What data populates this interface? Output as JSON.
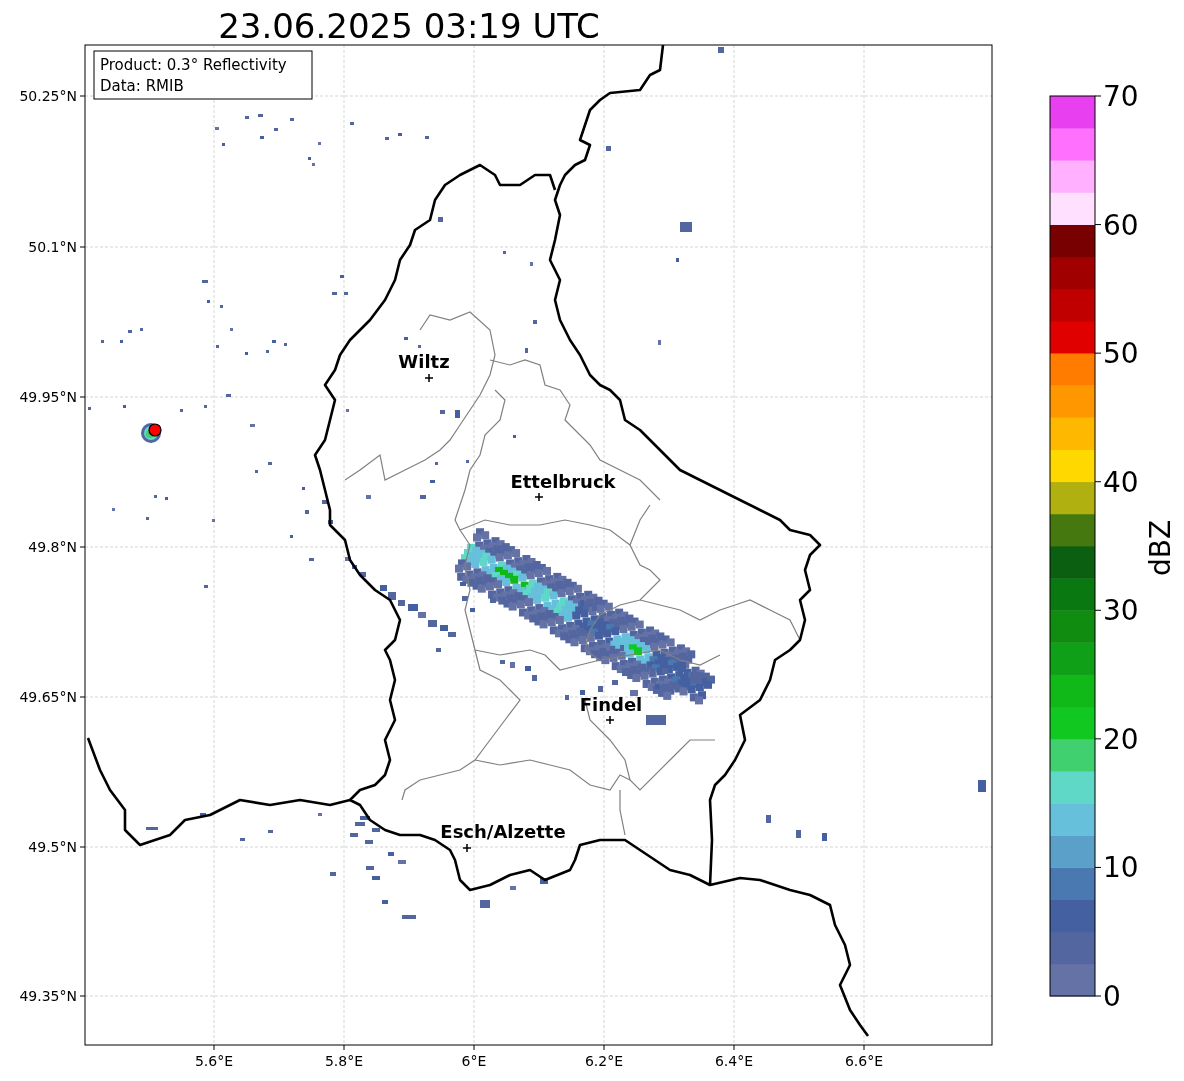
{
  "title": "23.06.2025 03:19 UTC",
  "info_box": [
    "Product: 0.3° Reflectivity",
    "Data: RMIB"
  ],
  "y_axis": {
    "ticks": [
      "50.25°N",
      "50.1°N",
      "49.95°N",
      "49.8°N",
      "49.65°N",
      "49.5°N",
      "49.35°N"
    ]
  },
  "x_axis": {
    "ticks": [
      "5.6°E",
      "5.8°E",
      "6°E",
      "6.2°E",
      "6.4°E",
      "6.6°E"
    ]
  },
  "cities": [
    {
      "name": "Wiltz"
    },
    {
      "name": "Ettelbruck"
    },
    {
      "name": "Findel"
    },
    {
      "name": "Esch/Alzette"
    }
  ],
  "colorbar": {
    "label": "dBZ",
    "ticks": [
      "70",
      "60",
      "50",
      "40",
      "30",
      "20",
      "10",
      "0"
    ],
    "bins": [
      {
        "color": "#6472a6"
      },
      {
        "color": "#5366a0"
      },
      {
        "color": "#4560a0"
      },
      {
        "color": "#4a78b0"
      },
      {
        "color": "#5aa0c8"
      },
      {
        "color": "#66c0dc"
      },
      {
        "color": "#60d8c8"
      },
      {
        "color": "#40d070"
      },
      {
        "color": "#10c820"
      },
      {
        "color": "#10b818"
      },
      {
        "color": "#10a018"
      },
      {
        "color": "#108c10"
      },
      {
        "color": "#0a7810"
      },
      {
        "color": "#0a6010"
      },
      {
        "color": "#467810"
      },
      {
        "color": "#b0b010"
      },
      {
        "color": "#ffd800"
      },
      {
        "color": "#ffb800"
      },
      {
        "color": "#ff9800"
      },
      {
        "color": "#ff7c00"
      },
      {
        "color": "#e00000"
      },
      {
        "color": "#c00000"
      },
      {
        "color": "#a00000"
      },
      {
        "color": "#780000"
      },
      {
        "color": "#ffe0ff"
      },
      {
        "color": "#ffb0ff"
      },
      {
        "color": "#ff70ff"
      },
      {
        "color": "#e840f0"
      }
    ]
  }
}
